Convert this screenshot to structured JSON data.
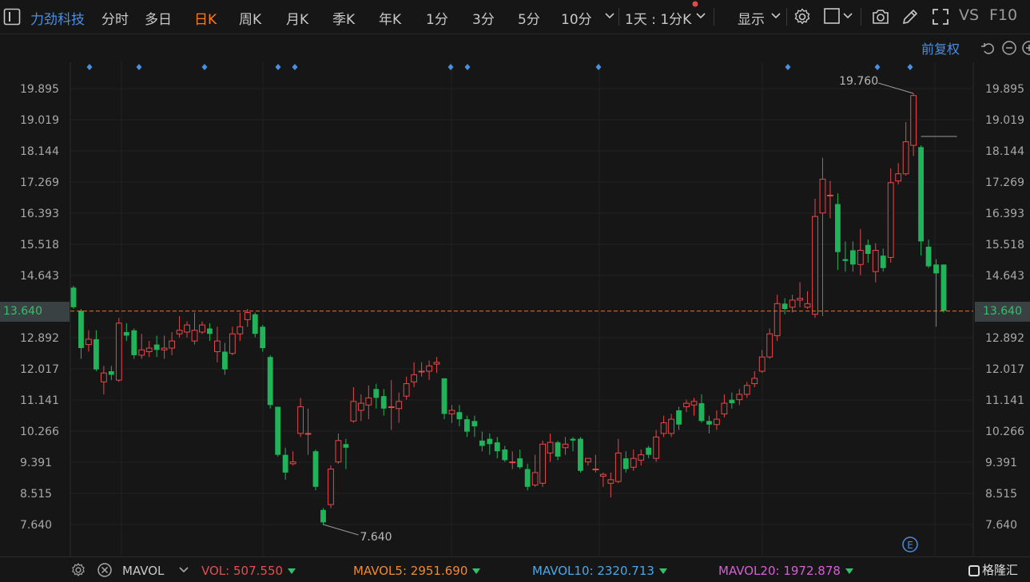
{
  "toolbar": {
    "stock_name": "力劲科技",
    "periods": [
      "分时",
      "多日",
      "日K",
      "周K",
      "月K",
      "季K",
      "年K",
      "1分",
      "3分",
      "5分",
      "10分"
    ],
    "active_period": "日K",
    "interval_selector": "1天 : 1分K",
    "display_menu": "显示",
    "vs_label": "VS",
    "f10_label": "F10",
    "adjust_label": "前复权"
  },
  "axis": {
    "price_ticks": [
      "19.895",
      "19.019",
      "18.144",
      "17.269",
      "16.393",
      "15.518",
      "14.643",
      "13.640",
      "12.892",
      "12.017",
      "11.141",
      "10.266",
      "9.391",
      "8.515",
      "7.640"
    ],
    "current_price": "13.640"
  },
  "chart_data": {
    "type": "candlestick",
    "ylim": [
      7.2,
      20.6
    ],
    "current_price": 13.64,
    "high_annotation": "19.760",
    "low_annotation": "7.640",
    "high_value": 19.76,
    "low_value": 7.64,
    "event_markers": 12,
    "candles": [
      [
        14.3,
        13.75,
        14.35,
        13.7
      ],
      [
        13.65,
        12.6,
        13.7,
        12.3
      ],
      [
        12.7,
        12.85,
        13.1,
        12.5
      ],
      [
        12.85,
        12.0,
        13.1,
        11.95
      ],
      [
        11.65,
        11.9,
        12.1,
        11.3
      ],
      [
        11.95,
        11.85,
        12.1,
        11.7
      ],
      [
        11.7,
        13.3,
        13.45,
        11.65
      ],
      [
        13.05,
        12.95,
        13.3,
        12.8
      ],
      [
        13.1,
        12.4,
        13.15,
        12.3
      ],
      [
        12.4,
        12.55,
        13.0,
        12.3
      ],
      [
        12.5,
        12.6,
        12.8,
        12.35
      ],
      [
        12.7,
        12.55,
        12.95,
        12.35
      ],
      [
        12.55,
        12.6,
        12.95,
        12.3
      ],
      [
        12.6,
        12.8,
        13.05,
        12.4
      ],
      [
        13.0,
        13.1,
        13.5,
        12.9
      ],
      [
        13.05,
        13.25,
        13.35,
        12.9
      ],
      [
        12.8,
        13.1,
        13.6,
        12.7
      ],
      [
        13.05,
        13.25,
        13.35,
        13.0
      ],
      [
        13.15,
        13.0,
        13.3,
        12.8
      ],
      [
        12.5,
        12.8,
        13.2,
        12.2
      ],
      [
        12.5,
        12.0,
        12.75,
        11.85
      ],
      [
        12.45,
        13.0,
        13.2,
        12.4
      ],
      [
        13.0,
        13.2,
        13.6,
        12.8
      ],
      [
        13.4,
        13.6,
        13.7,
        13.2
      ],
      [
        13.55,
        13.0,
        13.6,
        12.9
      ],
      [
        13.2,
        12.6,
        13.25,
        12.5
      ],
      [
        12.35,
        11.0,
        12.4,
        10.9
      ],
      [
        10.95,
        9.6,
        10.95,
        9.55
      ],
      [
        9.6,
        9.1,
        9.8,
        8.9
      ],
      [
        9.35,
        9.4,
        9.7,
        9.3
      ],
      [
        10.2,
        10.95,
        11.2,
        10.1
      ],
      [
        10.2,
        10.2,
        10.9,
        9.6
      ],
      [
        9.7,
        8.7,
        9.75,
        8.6
      ],
      [
        8.05,
        7.7,
        8.1,
        7.62
      ],
      [
        8.2,
        9.2,
        9.3,
        8.1
      ],
      [
        9.4,
        10.0,
        10.2,
        9.35
      ],
      [
        9.9,
        9.8,
        10.05,
        9.2
      ],
      [
        10.55,
        11.1,
        11.5,
        10.5
      ],
      [
        10.85,
        11.05,
        11.3,
        10.55
      ],
      [
        11.0,
        11.2,
        11.55,
        10.6
      ],
      [
        11.45,
        11.2,
        11.6,
        10.9
      ],
      [
        11.25,
        10.9,
        11.45,
        10.7
      ],
      [
        10.95,
        10.95,
        11.7,
        10.3
      ],
      [
        10.9,
        11.1,
        11.35,
        10.5
      ],
      [
        11.25,
        11.6,
        11.8,
        11.15
      ],
      [
        11.65,
        11.85,
        12.2,
        11.5
      ],
      [
        11.95,
        11.95,
        12.2,
        11.8
      ],
      [
        11.95,
        12.1,
        12.25,
        11.7
      ],
      [
        12.15,
        12.2,
        12.35,
        11.9
      ],
      [
        11.75,
        10.75,
        11.75,
        10.6
      ],
      [
        10.75,
        10.85,
        11.0,
        10.5
      ],
      [
        10.8,
        10.6,
        11.0,
        10.4
      ],
      [
        10.6,
        10.25,
        10.7,
        10.1
      ],
      [
        10.55,
        10.4,
        10.7,
        10.1
      ],
      [
        10.0,
        9.85,
        10.25,
        9.7
      ],
      [
        10.05,
        9.9,
        10.2,
        9.6
      ],
      [
        9.95,
        9.7,
        10.1,
        9.5
      ],
      [
        9.75,
        9.45,
        9.85,
        9.4
      ],
      [
        9.4,
        9.4,
        9.7,
        9.2
      ],
      [
        9.5,
        9.25,
        9.75,
        9.2
      ],
      [
        9.2,
        8.7,
        9.35,
        8.6
      ],
      [
        8.75,
        9.1,
        9.6,
        8.7
      ],
      [
        8.8,
        9.9,
        10.0,
        8.7
      ],
      [
        9.65,
        9.95,
        10.2,
        9.4
      ],
      [
        9.95,
        9.55,
        10.0,
        9.45
      ],
      [
        9.8,
        9.9,
        10.1,
        9.6
      ],
      [
        10.05,
        10.0,
        10.1,
        9.7
      ],
      [
        10.05,
        9.15,
        10.1,
        9.1
      ],
      [
        9.4,
        9.5,
        9.5,
        9.3
      ],
      [
        9.2,
        9.2,
        9.6,
        9.1
      ],
      [
        9.0,
        9.05,
        9.1,
        8.7
      ],
      [
        8.8,
        8.9,
        9.1,
        8.4
      ],
      [
        8.85,
        9.65,
        10.05,
        8.8
      ],
      [
        9.5,
        9.2,
        9.7,
        9.1
      ],
      [
        9.25,
        9.5,
        9.75,
        9.15
      ],
      [
        9.45,
        9.6,
        9.75,
        9.3
      ],
      [
        9.8,
        9.6,
        9.85,
        9.5
      ],
      [
        9.5,
        10.1,
        10.3,
        9.4
      ],
      [
        10.2,
        10.5,
        10.7,
        10.1
      ],
      [
        10.2,
        10.6,
        10.75,
        10.1
      ],
      [
        10.85,
        10.45,
        10.95,
        10.3
      ],
      [
        10.95,
        11.05,
        11.15,
        10.8
      ],
      [
        11.0,
        11.1,
        11.2,
        10.7
      ],
      [
        11.05,
        10.55,
        11.3,
        10.5
      ],
      [
        10.55,
        10.45,
        10.7,
        10.2
      ],
      [
        10.45,
        10.6,
        10.85,
        10.3
      ],
      [
        10.75,
        11.05,
        11.3,
        10.65
      ],
      [
        11.15,
        11.05,
        11.35,
        10.9
      ],
      [
        11.15,
        11.3,
        11.45,
        11.0
      ],
      [
        11.3,
        11.55,
        11.65,
        11.2
      ],
      [
        11.6,
        11.75,
        11.95,
        11.5
      ],
      [
        11.95,
        12.35,
        12.55,
        11.9
      ],
      [
        12.35,
        13.0,
        13.15,
        12.3
      ],
      [
        12.95,
        13.85,
        14.1,
        12.8
      ],
      [
        13.85,
        13.7,
        14.0,
        13.55
      ],
      [
        13.75,
        13.95,
        14.1,
        13.6
      ],
      [
        13.95,
        14.0,
        14.45,
        13.75
      ],
      [
        13.75,
        13.85,
        14.2,
        13.7
      ],
      [
        13.55,
        16.3,
        16.8,
        13.45
      ],
      [
        16.4,
        17.35,
        17.95,
        13.5
      ],
      [
        16.9,
        16.9,
        17.3,
        16.25
      ],
      [
        16.65,
        15.3,
        16.95,
        14.8
      ],
      [
        15.1,
        15.05,
        15.6,
        14.75
      ],
      [
        15.35,
        14.95,
        15.6,
        14.75
      ],
      [
        14.95,
        15.35,
        15.95,
        14.65
      ],
      [
        15.5,
        15.25,
        15.65,
        15.0
      ],
      [
        14.75,
        15.35,
        15.55,
        14.45
      ],
      [
        15.2,
        14.85,
        15.4,
        14.75
      ],
      [
        15.15,
        17.25,
        17.65,
        15.0
      ],
      [
        17.3,
        17.5,
        17.8,
        17.2
      ],
      [
        17.5,
        18.4,
        18.95,
        17.45
      ],
      [
        18.3,
        19.7,
        19.76,
        18.0
      ],
      [
        18.25,
        15.6,
        18.3,
        15.2
      ],
      [
        15.45,
        14.9,
        15.65,
        14.85
      ],
      [
        14.95,
        14.7,
        15.1,
        13.2
      ],
      [
        14.95,
        13.65,
        14.95,
        13.6
      ]
    ]
  },
  "indicators": {
    "settings_icon": "gear-icon",
    "close_icon": "close-icon",
    "name": "MAVOL",
    "vol_label": "VOL:",
    "vol_value": "507.550",
    "mavol5_label": "MAVOL5:",
    "mavol5_value": "2951.690",
    "mavol10_label": "MAVOL10:",
    "mavol10_value": "2320.713",
    "mavol20_label": "MAVOL20:",
    "mavol20_value": "1972.878",
    "colors": {
      "vol": "#e05050",
      "mavol5": "#f08a2c",
      "mavol10": "#4aa8e8",
      "mavol20": "#d65fd6"
    }
  },
  "brand": "格隆汇",
  "colors": {
    "up": "#e8474a",
    "down": "#20b35a",
    "accent": "#4a8fe0",
    "active": "#ff7a1a",
    "price_line": "#e8762a"
  }
}
